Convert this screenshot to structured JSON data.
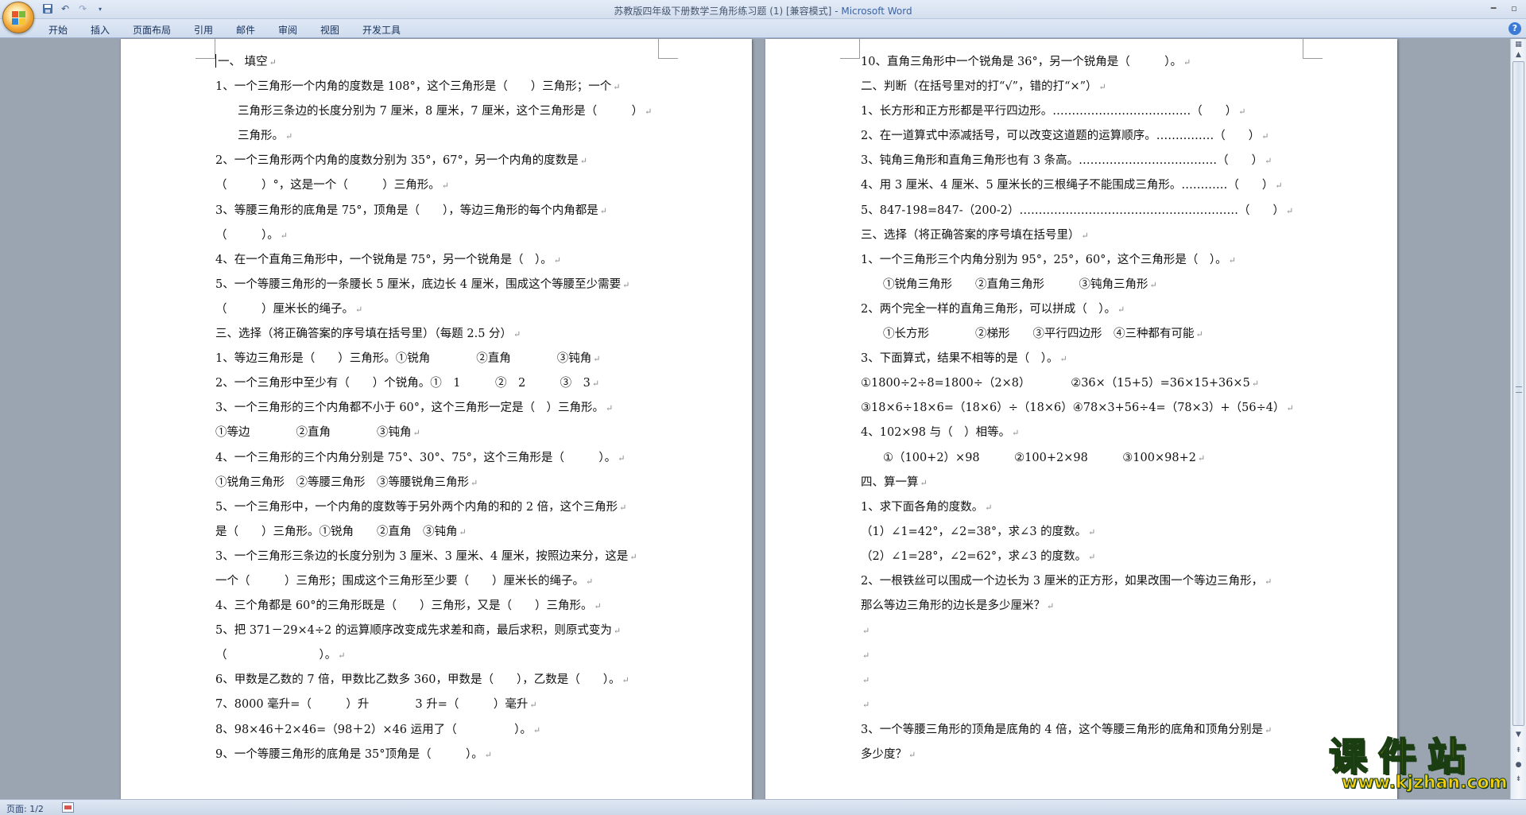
{
  "window": {
    "title": "苏教版四年级下册数学三角形练习题 (1) [兼容模式]",
    "app_suffix": " - Microsoft Word"
  },
  "menu": [
    "开始",
    "插入",
    "页面布局",
    "引用",
    "邮件",
    "审阅",
    "视图",
    "开发工具"
  ],
  "status": {
    "page": "页面: 1/2"
  },
  "watermark": {
    "main": "课件站",
    "url": "www.kjzhan.com"
  },
  "page1": [
    "一、 填空",
    "1、一个三角形一个内角的度数是 108°，这个三角形是（　　）三角形；一个",
    "三角形三条边的长度分别为 7 厘米，8 厘米，7 厘米，这个三角形是（　　　）",
    "三角形。",
    "2、一个三角形两个内角的度数分别为 35°，67°，另一个内角的度数是",
    "（　　　）°，这是一个（　　　）三角形。",
    "3、等腰三角形的底角是 75°，顶角是（　　），等边三角形的每个内角都是",
    "（　　　）。",
    "4、在一个直角三角形中，一个锐角是 75°，另一个锐角是（　）。",
    "5、一个等腰三角形的一条腰长 5 厘米，底边长 4 厘米，围成这个等腰至少需要",
    "（　　　）厘米长的绳子。",
    "三、选择（将正确答案的序号填在括号里）（每题 2.5 分）",
    "1、等边三角形是（　　）三角形。①锐角　　　　②直角　　　　③钝角",
    "2、一个三角形中至少有（　　）个锐角。①　1　　　②　2　　　③　3",
    "3、一个三角形的三个内角都不小于 60°，这个三角形一定是（　）三角形。",
    "①等边　　　　②直角　　　　③钝角",
    "4、一个三角形的三个内角分别是 75°、30°、75°，这个三角形是（　　　）。",
    "①锐角三角形　②等腰三角形　③等腰锐角三角形",
    "5、一个三角形中，一个内角的度数等于另外两个内角的和的 2 倍，这个三角形",
    "是（　　）三角形。①锐角　　②直角　③钝角",
    "3、一个三角形三条边的长度分别为 3 厘米、3 厘米、4 厘米，按照边来分，这是",
    "一个（　　　）三角形；围成这个三角形至少要（　　）厘米长的绳子。",
    "4、三个角都是 60°的三角形既是（　　）三角形，又是（　　）三角形。",
    "5、把 371－29×4÷2 的运算顺序改变成先求差和商，最后求积，则原式变为",
    "（　　　　　　　　）。",
    "6、甲数是乙数的 7 倍，甲数比乙数多 360，甲数是（　　），乙数是（　　）。",
    "7、8000 毫升=（　　　）升　　　　3 升=（　　　）毫升",
    "8、98×46＋2×46=（98＋2）×46 运用了（　　　　　）。",
    "9、一个等腰三角形的底角是 35°顶角是（　　　）。"
  ],
  "page2": [
    "10、直角三角形中一个锐角是 36°，另一个锐角是（　　　）。",
    "二、判断（在括号里对的打“√”，错的打“×”）",
    "1、长方形和正方形都是平行四边形。………………………………（　　）",
    "2、在一道算式中添减括号，可以改变这道题的运算顺序。……………（　　）",
    "3、钝角三角形和直角三角形也有 3 条高。………………………………（　　）",
    "4、用 3 厘米、4 厘米、5 厘米长的三根绳子不能围成三角形。…………（　　）",
    "5、847-198=847-（200-2）…………………………………………………（　　）",
    "三、选择（将正确答案的序号填在括号里）",
    "1、一个三角形三个内角分别为 95°，25°，60°，这个三角形是（　）。",
    "①锐角三角形　　②直角三角形　　　③钝角三角形",
    "2、两个完全一样的直角三角形，可以拼成（　）。",
    "①长方形　　　　②梯形　　③平行四边形　④三种都有可能",
    "3、下面算式，结果不相等的是（　）。",
    "①1800÷2÷8=1800÷（2×8）　　　　②36×（15+5）=36×15+36×5",
    "③18×6÷18×6=（18×6）÷（18×6）④78×3+56÷4=（78×3）+（56÷4）",
    "4、102×98 与（　）相等。",
    "①（100+2）×98　　　②100+2×98　　　③100×98+2",
    "四、算一算",
    "1、求下面各角的度数。",
    "（1）∠1=42°，∠2=38°，求∠3 的度数。",
    "（2）∠1=28°，∠2=62°，求∠3 的度数。",
    "2、一根铁丝可以围成一个边长为 3 厘米的正方形，如果改围一个等边三角形，",
    "那么等边三角形的边长是多少厘米？",
    "",
    "",
    "",
    "",
    "3、一个等腰三角形的顶角是底角的 4 倍，这个等腰三角形的底角和顶角分别是",
    "多少度？"
  ]
}
